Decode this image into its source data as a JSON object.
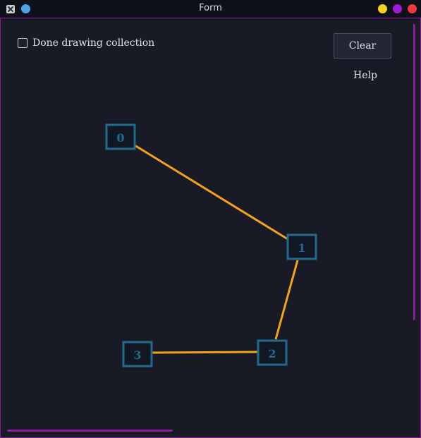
{
  "window": {
    "title": "Form"
  },
  "controls": {
    "done_checkbox_label": "Done drawing collection",
    "done_checked": false,
    "clear_label": "Clear",
    "help_label": "Help"
  },
  "graph": {
    "nodes": [
      {
        "id": "0",
        "label": "0"
      },
      {
        "id": "1",
        "label": "1"
      },
      {
        "id": "2",
        "label": "2"
      },
      {
        "id": "3",
        "label": "3"
      }
    ],
    "edges": [
      {
        "from": "0",
        "to": "1"
      },
      {
        "from": "1",
        "to": "2"
      },
      {
        "from": "2",
        "to": "3"
      }
    ]
  },
  "colors": {
    "edge": "#f2a21b",
    "node_border": "#1f6c8e",
    "node_fill": "#111823",
    "accent": "#8c1a9a"
  }
}
